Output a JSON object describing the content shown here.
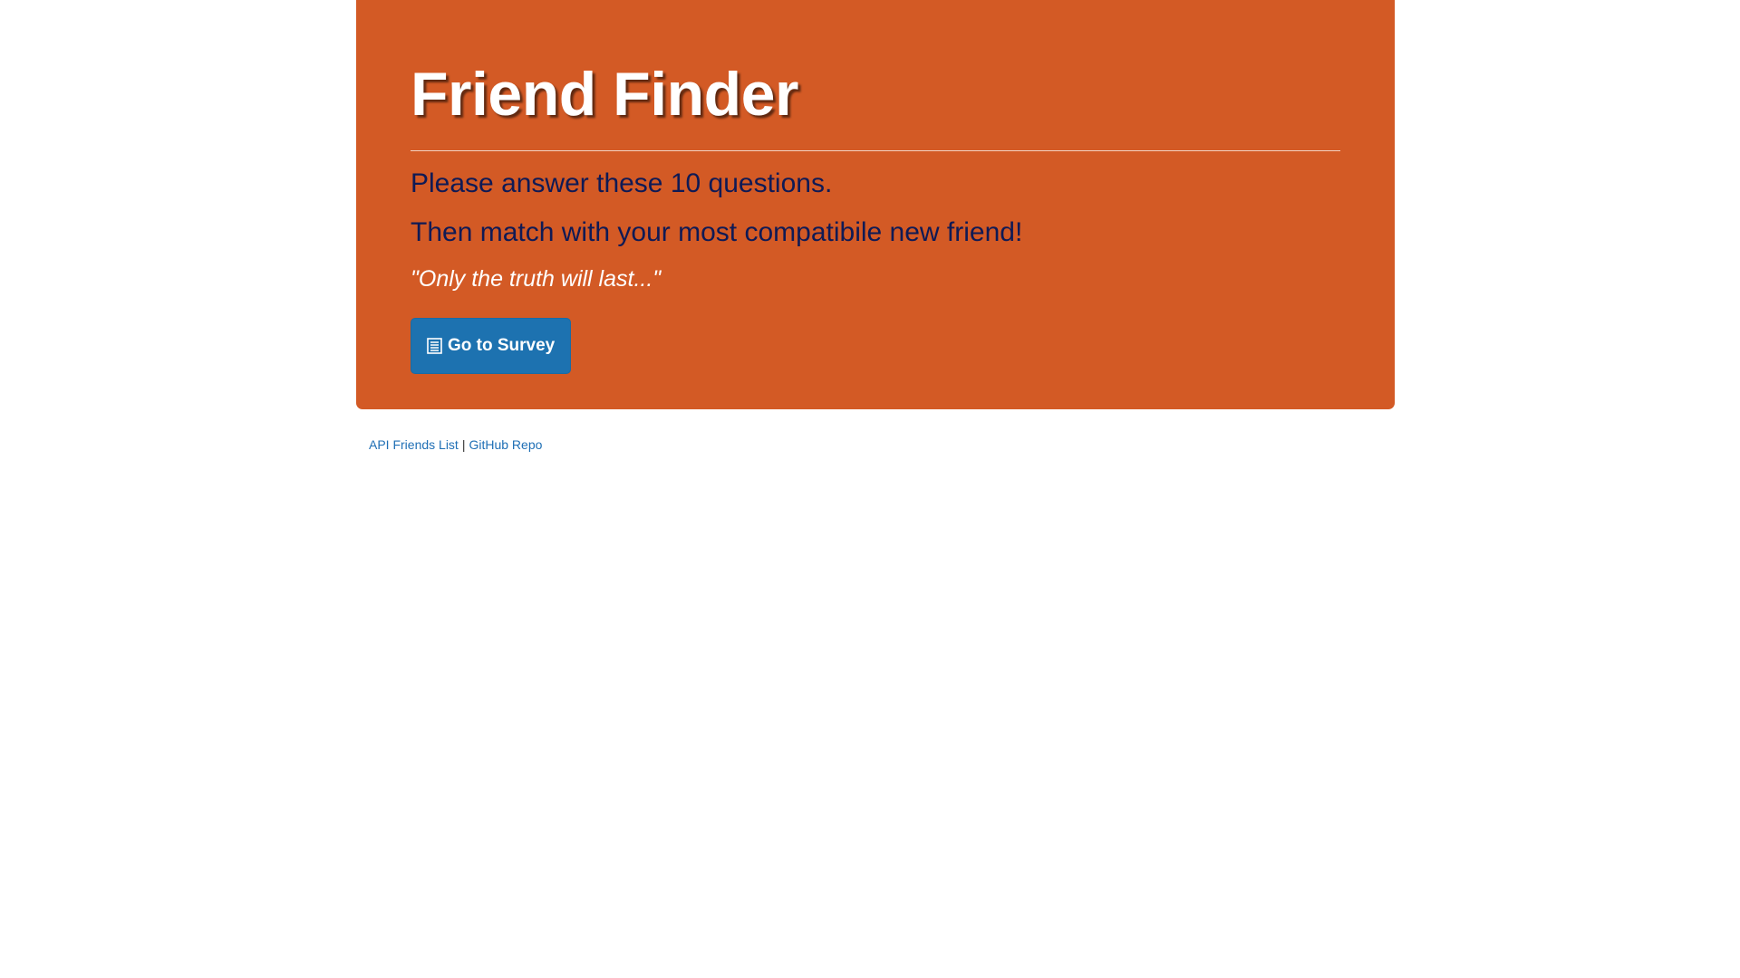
{
  "header": {
    "title": "Friend Finder"
  },
  "intro": {
    "line1": "Please answer these 10 questions.",
    "line2": "Then match with your most compatibile new friend!",
    "quote": "\"Only the truth will last...\""
  },
  "cta": {
    "label": "Go to Survey",
    "icon": "list-alt-icon"
  },
  "footer": {
    "link1": "API Friends List",
    "separator": "|",
    "link2": "GitHub Repo"
  },
  "colors": {
    "jumbotron_bg": "#d35a25",
    "button_bg": "#1d72b0",
    "subtitle_text": "#0f1a55",
    "link": "#1f6fb5"
  }
}
